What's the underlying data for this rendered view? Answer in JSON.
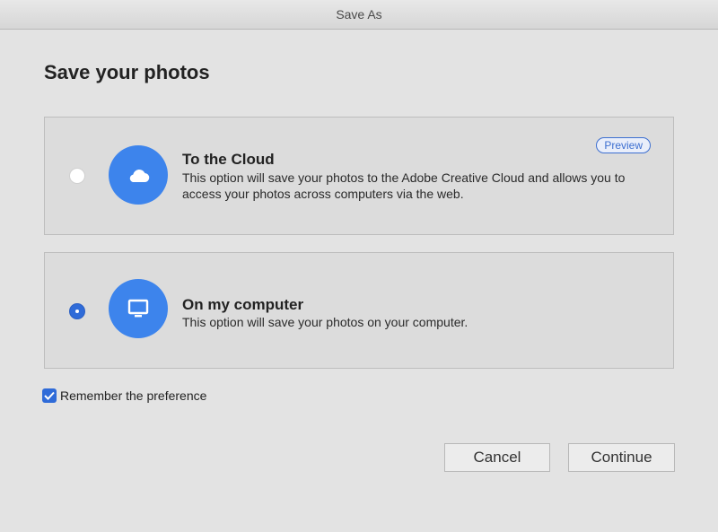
{
  "window": {
    "title": "Save As"
  },
  "dialog": {
    "heading": "Save your photos",
    "options": [
      {
        "title": "To the Cloud",
        "description": "This option will save your photos to the Adobe Creative Cloud and allows you to access your photos across computers via the web.",
        "badge": "Preview",
        "icon": "cloud-icon",
        "selected": false
      },
      {
        "title": "On my computer",
        "description": "This option will save your photos on your computer.",
        "icon": "monitor-icon",
        "selected": true
      }
    ],
    "remember": {
      "label": "Remember the preference",
      "checked": true
    },
    "buttons": {
      "cancel": "Cancel",
      "continue": "Continue"
    }
  },
  "colors": {
    "accent": "#3d84ec",
    "radio_selected": "#2f6bd8",
    "background": "#e3e3e3"
  }
}
